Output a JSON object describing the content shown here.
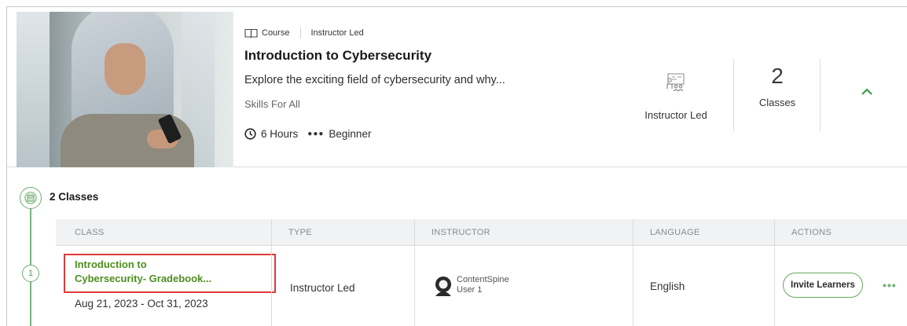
{
  "course": {
    "type_label": "Course",
    "delivery_label": "Instructor Led",
    "title": "Introduction to Cybersecurity",
    "description": "Explore the exciting field of cybersecurity and why...",
    "provider": "Skills For All",
    "duration": "6 Hours",
    "level": "Beginner",
    "summary_type_label": "Instructor Led",
    "class_count": "2",
    "class_count_label": "Classes"
  },
  "classes_section": {
    "heading": "2 Classes",
    "step_number": "1",
    "columns": [
      "CLASS",
      "TYPE",
      "INSTRUCTOR",
      "LANGUAGE",
      "ACTIONS"
    ],
    "rows": [
      {
        "class_name_line1": "Introduction to",
        "class_name_line2": "Cybersecurity- Gradebook...",
        "dates": "Aug 21, 2023 - Oct 31, 2023",
        "type": "Instructor Led",
        "instructor_line1": "ContentSpine",
        "instructor_line2": "User 1",
        "language": "English",
        "invite_label": "Invite Learners",
        "more_label": "•••"
      }
    ]
  },
  "colors": {
    "accent_green": "#6fae71",
    "link_green": "#4d8f1f",
    "highlight_red": "#e03a3a"
  },
  "icons": [
    "book-icon",
    "clock-icon",
    "level-dots-icon",
    "instructor-led-icon",
    "chevron-up-icon",
    "calendar-icon",
    "avatar-icon",
    "more-options-icon"
  ]
}
